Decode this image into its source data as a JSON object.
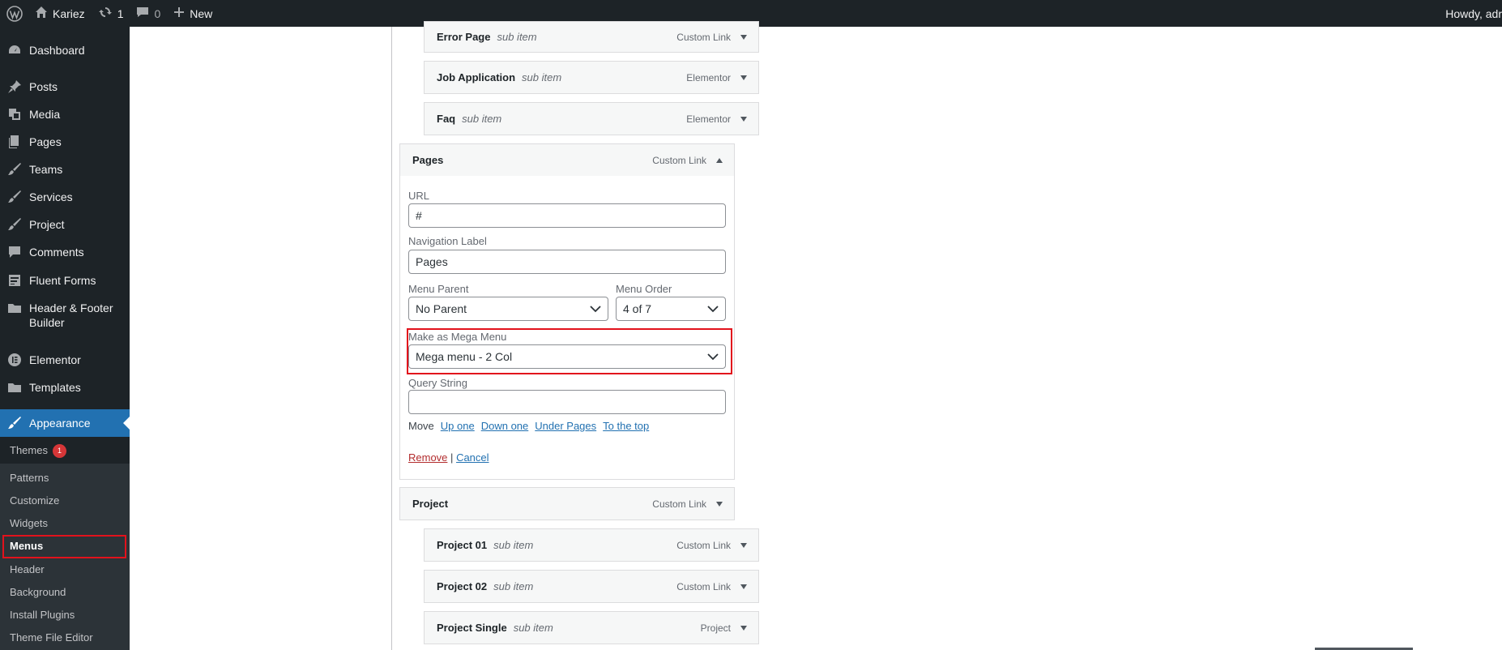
{
  "admin_bar": {
    "site_name": "Kariez",
    "updates_count": "1",
    "comments_count": "0",
    "new_label": "New",
    "howdy": "Howdy, adr"
  },
  "sidebar": {
    "items": [
      {
        "label": "Dashboard",
        "icon": "dashboard-icon"
      },
      {
        "label": "Posts",
        "icon": "pin-icon"
      },
      {
        "label": "Media",
        "icon": "media-icon"
      },
      {
        "label": "Pages",
        "icon": "pages-icon"
      },
      {
        "label": "Teams",
        "icon": "brush-icon"
      },
      {
        "label": "Services",
        "icon": "brush-icon"
      },
      {
        "label": "Project",
        "icon": "brush-icon"
      },
      {
        "label": "Comments",
        "icon": "comment-icon"
      },
      {
        "label": "Fluent Forms",
        "icon": "forms-icon"
      },
      {
        "label": "Header & Footer Builder",
        "icon": "folder-icon"
      },
      {
        "label": "Elementor",
        "icon": "elementor-icon"
      },
      {
        "label": "Templates",
        "icon": "folder-icon"
      },
      {
        "label": "Appearance",
        "icon": "paintbrush-icon"
      }
    ],
    "submenu": [
      {
        "label": "Themes",
        "badge": "1"
      },
      {
        "label": "Patterns"
      },
      {
        "label": "Customize"
      },
      {
        "label": "Widgets"
      },
      {
        "label": "Menus"
      },
      {
        "label": "Header"
      },
      {
        "label": "Background"
      },
      {
        "label": "Install Plugins"
      },
      {
        "label": "Theme File Editor"
      }
    ]
  },
  "menu_items": {
    "error_page": {
      "title": "Error Page",
      "sub": "sub item",
      "type": "Custom Link"
    },
    "job_application": {
      "title": "Job Application",
      "sub": "sub item",
      "type": "Elementor"
    },
    "faq": {
      "title": "Faq",
      "sub": "sub item",
      "type": "Elementor"
    },
    "pages": {
      "title": "Pages",
      "type": "Custom Link"
    },
    "project": {
      "title": "Project",
      "type": "Custom Link"
    },
    "project_01": {
      "title": "Project 01",
      "sub": "sub item",
      "type": "Custom Link"
    },
    "project_02": {
      "title": "Project 02",
      "sub": "sub item",
      "type": "Custom Link"
    },
    "project_single": {
      "title": "Project Single",
      "sub": "sub item",
      "type": "Project"
    }
  },
  "settings": {
    "url_label": "URL",
    "url_value": "#",
    "nav_label": "Navigation Label",
    "nav_value": "Pages",
    "parent_label": "Menu Parent",
    "parent_value": "No Parent",
    "order_label": "Menu Order",
    "order_value": "4 of 7",
    "mega_label": "Make as Mega Menu",
    "mega_value": "Mega menu - 2 Col",
    "query_label": "Query String",
    "query_value": "",
    "move_label": "Move",
    "move_links": [
      "Up one",
      "Down one",
      "Under Pages",
      "To the top"
    ],
    "remove_label": "Remove",
    "separator": "|",
    "cancel_label": "Cancel"
  },
  "colors": {
    "admin_dark": "#1d2327",
    "accent_blue": "#2271b1",
    "highlight_red": "#e2121c",
    "badge_red": "#d63638"
  }
}
